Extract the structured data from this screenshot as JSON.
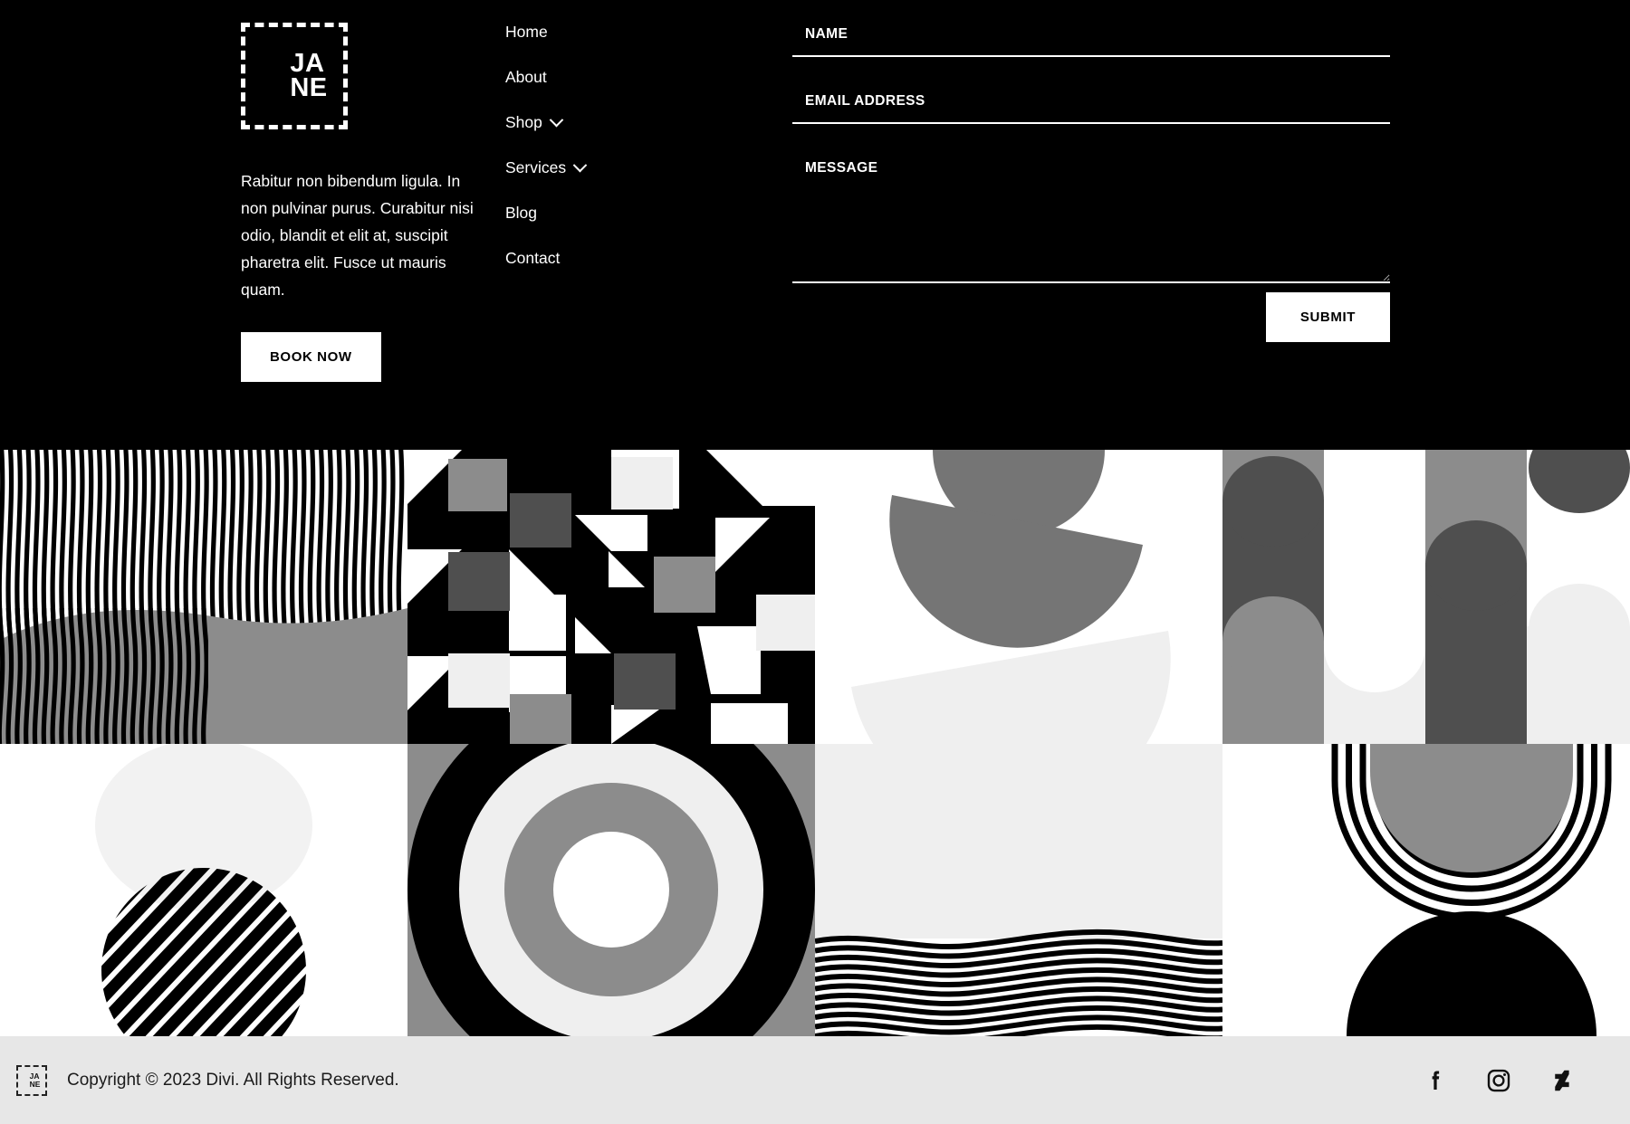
{
  "brand": {
    "logo_text": "JA\nNE",
    "description": "Rabitur non bibendum ligula. In non pulvinar purus. Curabitur nisi odio, blandit et elit at, suscipit pharetra elit. Fusce ut mauris quam.",
    "book_button": "BOOK NOW"
  },
  "nav": {
    "items": [
      {
        "label": "Home",
        "has_submenu": false
      },
      {
        "label": "About",
        "has_submenu": false
      },
      {
        "label": "Shop",
        "has_submenu": true
      },
      {
        "label": "Services",
        "has_submenu": true
      },
      {
        "label": "Blog",
        "has_submenu": false
      },
      {
        "label": "Contact",
        "has_submenu": false
      }
    ]
  },
  "contact_form": {
    "name_placeholder": "NAME",
    "name_value": "",
    "email_placeholder": "EMAIL ADDRESS",
    "email_value": "",
    "message_placeholder": "MESSAGE",
    "message_value": "",
    "submit_label": "SUBMIT"
  },
  "gallery": {
    "tiles": [
      {
        "name": "wavy-vertical-stripes-with-gray-hill",
        "row": 1,
        "col": 1
      },
      {
        "name": "geometric-houndstooth-blocks",
        "row": 1,
        "col": 2
      },
      {
        "name": "gray-semicircle-bowls",
        "row": 1,
        "col": 3
      },
      {
        "name": "gray-arch-columns",
        "row": 1,
        "col": 4
      },
      {
        "name": "diagonal-striped-circle",
        "row": 2,
        "col": 1
      },
      {
        "name": "concentric-circles-target",
        "row": 2,
        "col": 2
      },
      {
        "name": "horizontal-wave-lines",
        "row": 2,
        "col": 3
      },
      {
        "name": "concentric-arch-rings-with-black-dome",
        "row": 2,
        "col": 4
      }
    ]
  },
  "bottom_bar": {
    "mini_logo_text": "JA\nNE",
    "copyright": "Copyright © 2023 Divi. All Rights Reserved.",
    "social": [
      {
        "name": "facebook",
        "label": "Facebook"
      },
      {
        "name": "instagram",
        "label": "Instagram"
      },
      {
        "name": "deviantart",
        "label": "DeviantArt"
      }
    ]
  },
  "colors": {
    "footer_background": "#000000",
    "footer_text": "#ffffff",
    "bottom_bar_background": "#e7e7e7",
    "bottom_bar_text": "#1b1b1b",
    "accent_button_bg": "#ffffff",
    "accent_button_text": "#000000",
    "gray_mid": "#8c8c8c",
    "gray_dark": "#4f4f4f",
    "gray_light": "#efefef"
  }
}
